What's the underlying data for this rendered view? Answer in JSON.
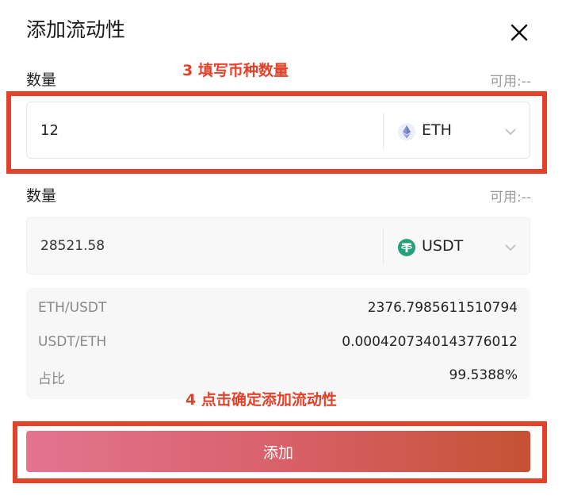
{
  "dialog": {
    "title": "添加流动性",
    "close_icon": "close-icon"
  },
  "annotations": {
    "step3": "3  填写币种数量",
    "step4": "4 点击确定添加流动性",
    "highlight_color": "#e2412a"
  },
  "field1": {
    "label": "数量",
    "available": "可用:--",
    "value": "12",
    "token": "ETH",
    "token_icon": "eth-icon"
  },
  "field2": {
    "label": "数量",
    "available": "可用:--",
    "value": "28521.58",
    "token": "USDT",
    "token_icon": "usdt-icon"
  },
  "info": {
    "rows": [
      {
        "label": "ETH/USDT",
        "value": "2376.7985611510794"
      },
      {
        "label": "USDT/ETH",
        "value": "0.0004207340143776012"
      },
      {
        "label": "占比",
        "value": "99.5388%"
      }
    ]
  },
  "submit": {
    "label": "添加",
    "gradient_start": "#e37490",
    "gradient_end": "#c65233"
  }
}
